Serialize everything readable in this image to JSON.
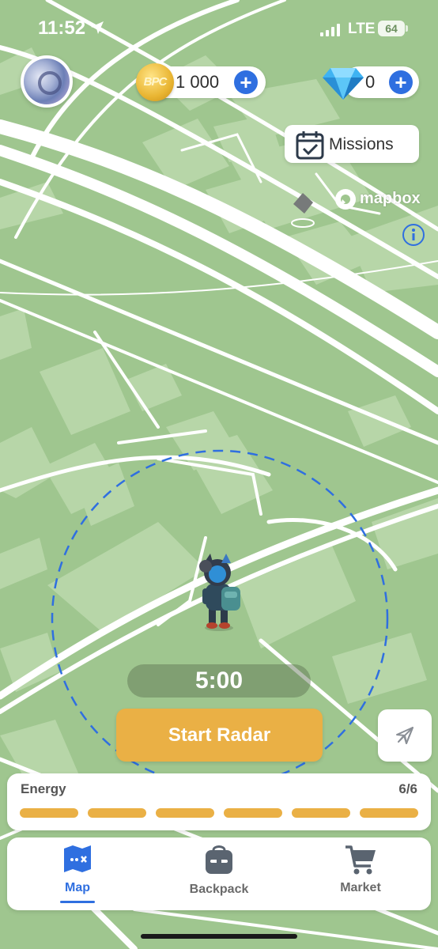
{
  "status_bar": {
    "time": "11:52",
    "network": "LTE",
    "battery": "64"
  },
  "currency": {
    "coin_icon_text": "BPC",
    "coins": "1 000",
    "gems": "0",
    "add_label": "+"
  },
  "missions": {
    "label": "Missions"
  },
  "map": {
    "attribution": "mapbox"
  },
  "radar": {
    "timer": "5:00",
    "start_label": "Start Radar"
  },
  "energy": {
    "label": "Energy",
    "count": "6/6",
    "current": 6,
    "max": 6
  },
  "tabs": [
    {
      "label": "Map",
      "icon": "map-icon",
      "active": true
    },
    {
      "label": "Backpack",
      "icon": "backpack-icon",
      "active": false
    },
    {
      "label": "Market",
      "icon": "cart-icon",
      "active": false
    }
  ],
  "colors": {
    "accent": "#2f6fe0",
    "radar_button": "#eab045",
    "energy": "#eab045",
    "map_ground": "#9fc68f",
    "road": "#ffffff"
  }
}
